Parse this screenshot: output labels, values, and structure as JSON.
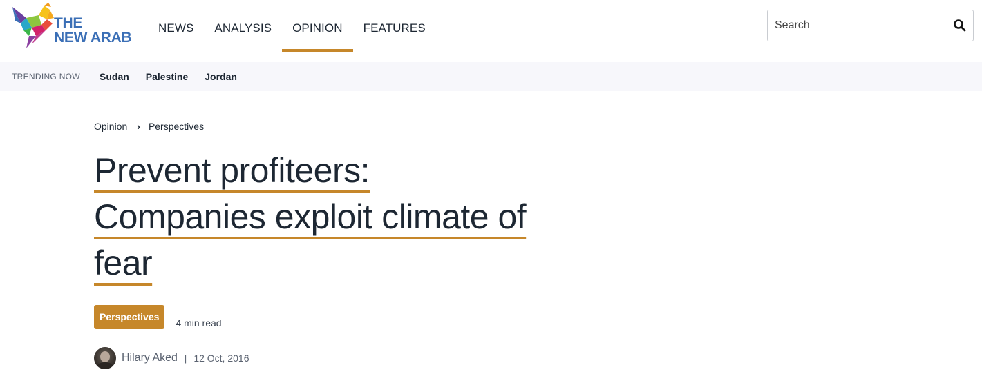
{
  "brand": {
    "line1": "THE",
    "line2": "NEW ARAB",
    "color": "#3b6fb6",
    "accent": "#c6872a"
  },
  "nav": {
    "items": [
      {
        "label": "NEWS",
        "active": false
      },
      {
        "label": "ANALYSIS",
        "active": false
      },
      {
        "label": "OPINION",
        "active": true
      },
      {
        "label": "FEATURES",
        "active": false
      }
    ]
  },
  "search": {
    "placeholder": "Search",
    "icon": "search-icon"
  },
  "trending": {
    "label": "TRENDING NOW",
    "links": [
      "Sudan",
      "Palestine",
      "Jordan"
    ]
  },
  "article": {
    "breadcrumb": [
      "Opinion",
      "Perspectives"
    ],
    "breadcrumb_separator": "›",
    "title_lines": [
      "Prevent profiteers:",
      "Companies exploit climate of",
      "fear"
    ],
    "tag": "Perspectives",
    "read_time": "4 min read",
    "author": "Hilary Aked",
    "meta_separator": "|",
    "date": "12 Oct, 2016"
  }
}
